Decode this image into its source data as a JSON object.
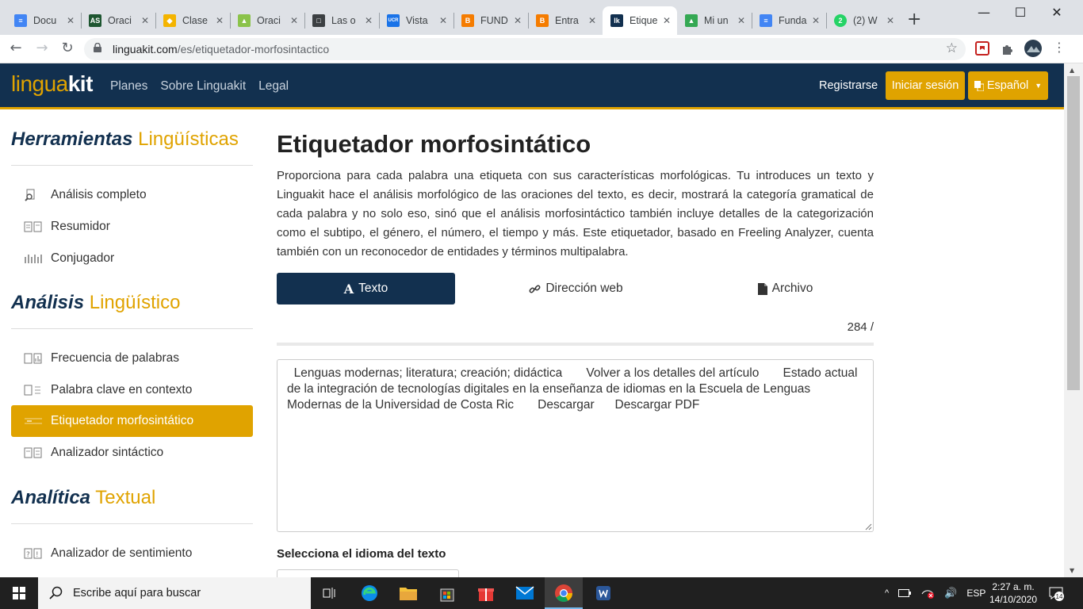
{
  "browser": {
    "tabs": [
      {
        "label": "Docu",
        "icon": "docs-icon",
        "color": "#4285f4"
      },
      {
        "label": "Oraci",
        "icon": "oraciones-icon",
        "color": "#1e5631"
      },
      {
        "label": "Clase",
        "icon": "clase-icon",
        "color": "#f4b400"
      },
      {
        "label": "Oraci",
        "icon": "book-icon",
        "color": "#8bc34a"
      },
      {
        "label": "Las o",
        "icon": "book-open-icon",
        "color": "#3c4043"
      },
      {
        "label": "Vista",
        "icon": "ucr-icon",
        "color": "#1a73e8"
      },
      {
        "label": "FUND",
        "icon": "blogger-icon",
        "color": "#f57c00"
      },
      {
        "label": "Entra",
        "icon": "blogger-icon",
        "color": "#f57c00"
      },
      {
        "label": "Etique",
        "icon": "linguakit-icon",
        "color": "#12304f"
      },
      {
        "label": "Mi un",
        "icon": "drive-icon",
        "color": "#34a853"
      },
      {
        "label": "Funda",
        "icon": "docs-icon",
        "color": "#4285f4"
      },
      {
        "label": "(2) W",
        "icon": "whatsapp-icon",
        "color": "#25d366"
      }
    ],
    "active_tab_index": 8,
    "url_domain": "linguakit.com",
    "url_path": "/es/etiquetador-morfosintactico"
  },
  "site": {
    "logo_part1": "lingua",
    "logo_part2": "kit",
    "nav": [
      "Planes",
      "Sobre Linguakit",
      "Legal"
    ],
    "register": "Registrarse",
    "login": "Iniciar sesión",
    "language": "Español",
    "brand_navy": "#12304f",
    "brand_gold": "#e0a300"
  },
  "sidebar": {
    "sections": [
      {
        "title_a": "Herramientas",
        "title_b": "Lingüísticas",
        "items": [
          {
            "label": "Análisis completo",
            "icon": "search-doc-icon"
          },
          {
            "label": "Resumidor",
            "icon": "summary-icon"
          },
          {
            "label": "Conjugador",
            "icon": "conjugation-icon"
          }
        ]
      },
      {
        "title_a": "Análisis",
        "title_b": "Lingüístico",
        "items": [
          {
            "label": "Frecuencia de palabras",
            "icon": "frequency-icon"
          },
          {
            "label": "Palabra clave en contexto",
            "icon": "keyword-icon"
          },
          {
            "label": "Etiquetador morfosintático",
            "icon": "tagger-icon",
            "active": true
          },
          {
            "label": "Analizador sintáctico",
            "icon": "parser-icon"
          }
        ]
      },
      {
        "title_a": "Analítica",
        "title_b": "Textual",
        "items": [
          {
            "label": "Analizador de sentimiento",
            "icon": "sentiment-icon"
          }
        ]
      }
    ]
  },
  "main": {
    "title": "Etiquetador morfosintático",
    "description": "Proporciona para cada palabra una etiqueta con sus características morfológicas. Tu introduces un texto y Linguakit hace el análisis morfológico de las oraciones del texto, es decir, mostrará la categoría gramatical de cada palabra y no solo eso, sinó que el análisis morfosintáctico también incluye detalles de la categorización como el subtipo, el género, el número, el tiempo y más. Este etiquetador, basado en Freeling Analyzer, cuenta también con un reconocedor de entidades y términos multipalabra.",
    "input_tabs": [
      {
        "label": "Texto",
        "icon": "font-icon"
      },
      {
        "label": "Dirección web",
        "icon": "link-icon"
      },
      {
        "label": "Archivo",
        "icon": "file-icon"
      }
    ],
    "char_counter": "284 /",
    "text_value": "  Lenguas modernas; literatura; creación; didáctica       Volver a los detalles del artículo       Estado actual de la integración de tecnologías digitales en la enseñanza de idiomas en la Escuela de Lenguas Modernas de la Universidad de Costa Ric       Descargar      Descargar PDF",
    "language_label": "Selecciona el idioma del texto"
  },
  "taskbar": {
    "search_placeholder": "Escribe aquí para buscar",
    "apps": [
      "task-view-icon",
      "edge-icon",
      "file-explorer-icon",
      "store-icon",
      "gift-icon",
      "mail-icon",
      "chrome-icon",
      "word-icon"
    ],
    "active_app": "chrome-icon",
    "lang": "ESP",
    "time": "2:27 a. m.",
    "date": "14/10/2020",
    "notifications": "14"
  }
}
